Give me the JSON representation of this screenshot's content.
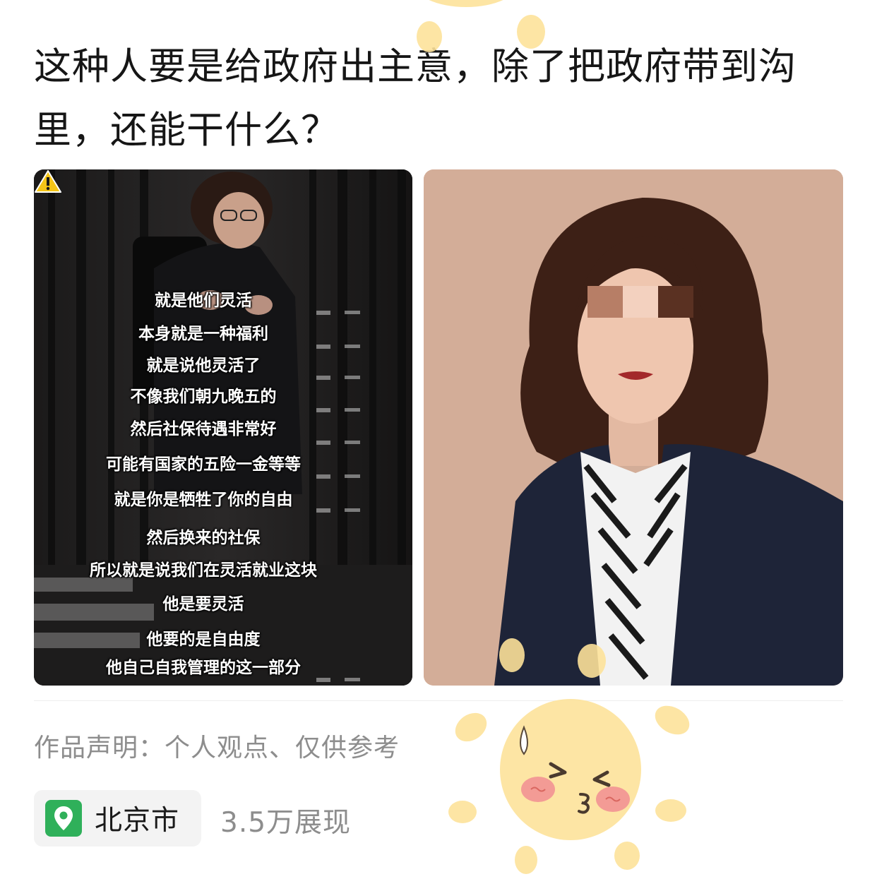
{
  "post": {
    "title": "这种人要是给政府出主意，除了把政府带到沟里，还能干什么？",
    "declaration": "作品声明：个人观点、仅供参考",
    "location": "北京市",
    "views": "3.5万展现"
  },
  "images": {
    "left_subtitles": [
      "就是他们灵活",
      "本身就是一种福利",
      "就是说他灵活了",
      "不像我们朝九晚五的",
      "然后社保待遇非常好",
      "可能有国家的五险一金等等",
      "就是你是牺牲了你的自由",
      "然后换来的社保",
      "所以就是说我们在灵活就业这块",
      "他是要灵活",
      "他要的是自由度",
      "他自己自我管理的这一部分"
    ]
  },
  "icons": {
    "location": "location-pin-icon",
    "warning": "warning-icon",
    "sticker": "sun-emoji-sticker"
  },
  "colors": {
    "location_pin": "#2fb05a",
    "muted_text": "#8d8d8d",
    "sticker_sun": "#fde39a"
  }
}
